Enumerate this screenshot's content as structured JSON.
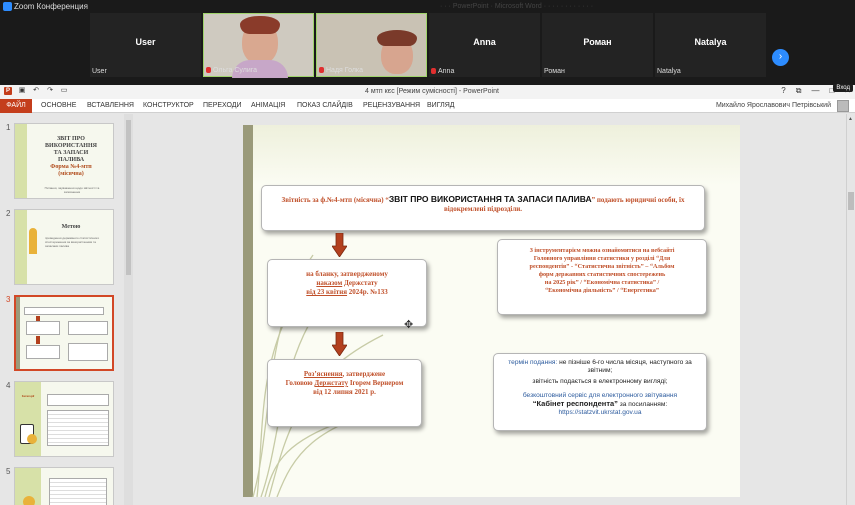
{
  "zoom": {
    "app_title": "Zoom Конференция",
    "ghost_text": "· · · PowerPoint · Microsoft Word · · · · · · · · · · · ·",
    "participants": [
      {
        "center_name": "User",
        "label": "User",
        "muted": false,
        "video": false
      },
      {
        "center_name": "",
        "label": "Ольга Сулига",
        "muted": true,
        "video": true
      },
      {
        "center_name": "",
        "label": "Надя Голка",
        "muted": true,
        "video": true
      },
      {
        "center_name": "Anna",
        "label": "Anna",
        "muted": true,
        "video": false
      },
      {
        "center_name": "Роман",
        "label": "Роман",
        "muted": false,
        "video": false
      },
      {
        "center_name": "Natalya",
        "label": "Natalya",
        "muted": false,
        "video": false
      }
    ],
    "next_glyph": "›"
  },
  "ppt": {
    "window_title": "4 мтп кєс [Режим сумісності] - PowerPoint",
    "controls": {
      "help": "?",
      "restore": "⧉",
      "minimize": "—",
      "maximize": "□",
      "close": "✕"
    },
    "tooltip": "Вход",
    "tabs": {
      "file": "ФАЙЛ",
      "items": [
        "ОСНОВНЕ",
        "ВСТАВЛЕННЯ",
        "КОНСТРУКТОР",
        "ПЕРЕХОДИ",
        "АНІМАЦІЯ",
        "ПОКАЗ СЛАЙДІВ",
        "РЕЦЕНЗУВАННЯ",
        "ВИГЛЯД"
      ]
    },
    "user_name": "Михайло Ярославович Петрівський",
    "slides": [
      {
        "num": "1",
        "title_lines": [
          "ЗВІТ ПРО",
          "ВИКОРИСТАННЯ",
          "ТА ЗАПАСИ",
          "ПАЛИВА"
        ],
        "red_lines": [
          "Форма №4-мтп",
          "(місячна)"
        ],
        "sub": "Питання, зауваження щодо звітності та заповнення"
      },
      {
        "num": "2",
        "title_lines": [
          "Метою"
        ],
        "red_lines": [],
        "sub": "проведення державного статистичного спостереження за використанням та запасами палива"
      },
      {
        "num": "3",
        "title_lines": [],
        "red_lines": [],
        "sub": ""
      },
      {
        "num": "4",
        "title_lines": [],
        "red_lines": [
          "Категорії"
        ],
        "sub": ""
      },
      {
        "num": "5",
        "title_lines": [],
        "red_lines": [],
        "sub": ""
      }
    ],
    "slide": {
      "box1": {
        "pre": "Звітність за ф.№4-мтп (місячна) “",
        "bold": "ЗВІТ ПРО ВИКОРИСТАННЯ ТА ЗАПАСИ ПАЛИВА",
        "post": "” подають юридичні особи, їх відокремлені підрозділи."
      },
      "box2": {
        "line1": "на бланку, затвердженому",
        "u1": "наказом",
        "line2b": " Держстату",
        "u2": "від 23 квітня",
        "line3b": " 2024р. №133"
      },
      "box3": {
        "u": "Роз’яснення",
        "line1b": ", затверджене",
        "line2a": "Головою ",
        "u2": "Держстату",
        "line2b": " Ігорем Вернером",
        "line3": "від 12 липня 2021 р."
      },
      "box4": {
        "lines": [
          "З інструментарієм можна ознайомитися на вебсайті",
          "Головного управління статистики у розділі “Для",
          "респондентів” - “Статистична звітність” – “Альбом",
          "форм державних статистичних спостережень",
          "на 2025 рік” / “Економічна статистика” /",
          "“Економічна діяльність” / “Енергетика”"
        ]
      },
      "box5": {
        "t1_label": "термін подання:",
        "t1_text": " не пізніше 6-го числа місяця,  наступного за звітним;",
        "t2": "звітність подається в електронному вигляді;",
        "t3_label": "безкоштовний сервіс для електронного звітування",
        "t3_bold": "“Кабінет респондента”",
        "t3_post": " за посиланням:",
        "t3_url": "https://statzvit.ukrstat.gov.ua"
      }
    }
  }
}
